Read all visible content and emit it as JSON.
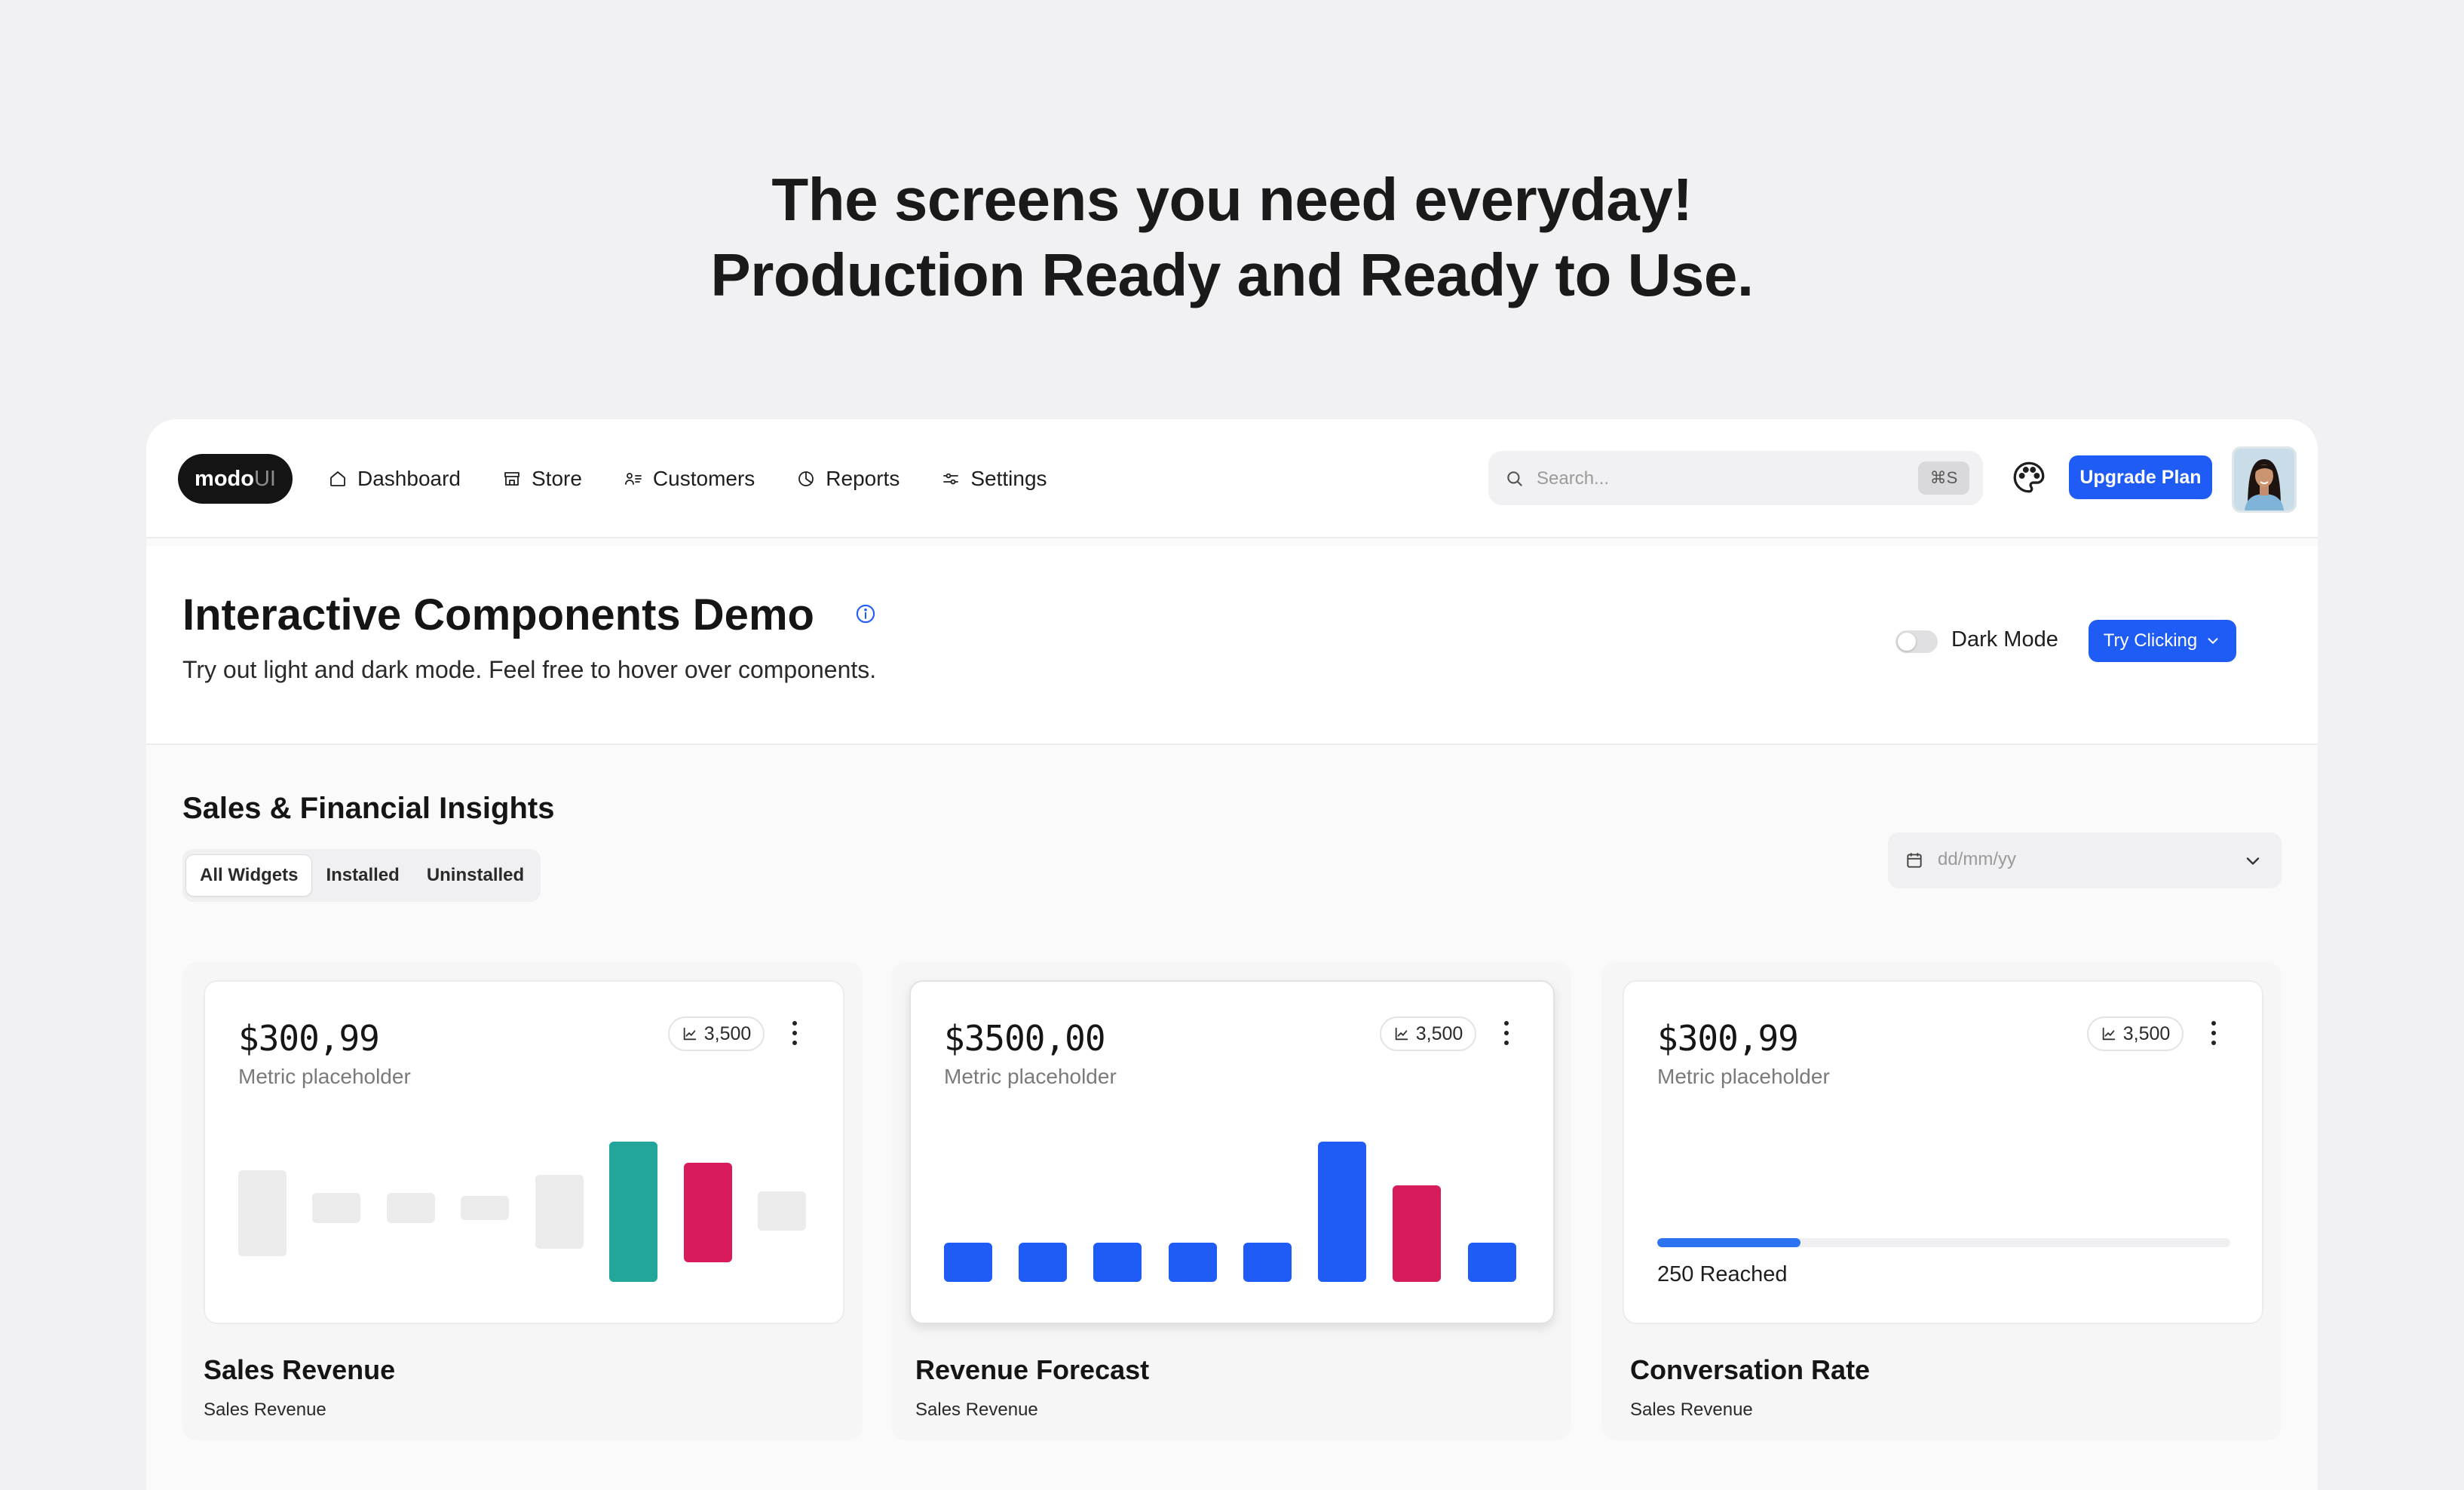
{
  "hero": {
    "line1": "The screens you need everyday!",
    "line2": "Production Ready and Ready to Use."
  },
  "topbar": {
    "logo_main": "modo",
    "logo_accent": "UI",
    "nav": [
      {
        "label": "Dashboard",
        "icon": "home-icon"
      },
      {
        "label": "Store",
        "icon": "store-icon"
      },
      {
        "label": "Customers",
        "icon": "customers-icon"
      },
      {
        "label": "Reports",
        "icon": "pie-chart-icon"
      },
      {
        "label": "Settings",
        "icon": "sliders-icon"
      }
    ],
    "search_placeholder": "Search...",
    "search_shortcut": "⌘S",
    "upgrade_label": "Upgrade Plan"
  },
  "header": {
    "title": "Interactive Components Demo",
    "subtitle": "Try out light and dark mode. Feel free to hover over components.",
    "dark_mode_label": "Dark Mode",
    "dark_mode_on": false,
    "try_label": "Try Clicking"
  },
  "section": {
    "title": "Sales & Financial Insights",
    "tabs": [
      "All Widgets",
      "Installed",
      "Uninstalled"
    ],
    "active_tab": "All Widgets",
    "date_placeholder": "dd/mm/yy"
  },
  "colors": {
    "accent": "#1f5bf5",
    "teal": "#22a699",
    "pink": "#d81b5c",
    "muted_bar": "#ebebeb",
    "progress": "#2b73f0"
  },
  "cards": [
    {
      "amount": "$300,99",
      "metric": "Metric placeholder",
      "badge": "3,500",
      "title": "Sales Revenue",
      "subtitle": "Sales Revenue"
    },
    {
      "amount": "$3500,00",
      "metric": "Metric placeholder",
      "badge": "3,500",
      "title": "Revenue Forecast",
      "subtitle": "Sales Revenue"
    },
    {
      "amount": "$300,99",
      "metric": "Metric placeholder",
      "badge": "3,500",
      "title": "Conversation Rate",
      "subtitle": "Sales Revenue",
      "progress_fraction": 0.25,
      "progress_label": "250 Reached"
    }
  ]
}
